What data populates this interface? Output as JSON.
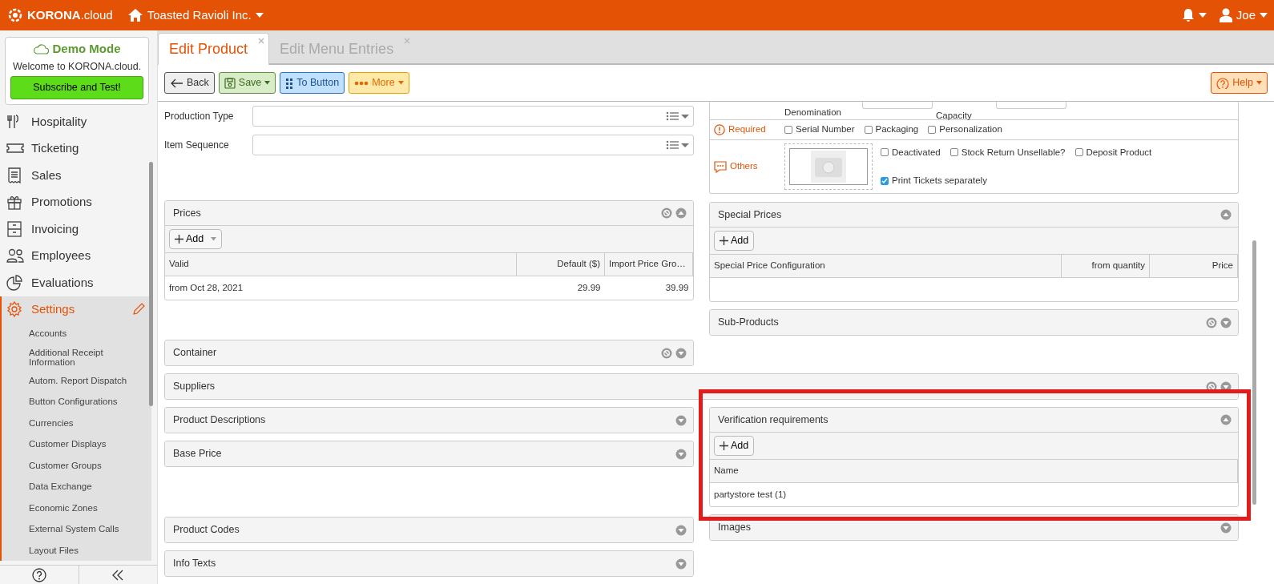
{
  "topbar": {
    "brand": "**KORONA**.cloud",
    "company": "Toasted Ravioli Inc.",
    "user": "Joe"
  },
  "demo": {
    "title": "Demo Mode",
    "text": "Welcome to KORONA.cloud.",
    "button": "Subscribe and Test!"
  },
  "sidebar": {
    "items": [
      {
        "label": "Hospitality",
        "selected": false
      },
      {
        "label": "Ticketing",
        "selected": false
      },
      {
        "label": "Sales",
        "selected": false
      },
      {
        "label": "Promotions",
        "selected": false
      },
      {
        "label": "Invoicing",
        "selected": false
      },
      {
        "label": "Employees",
        "selected": false
      },
      {
        "label": "Evaluations",
        "selected": false
      },
      {
        "label": "Settings",
        "selected": true,
        "children": [
          "Accounts",
          "Additional Receipt Information",
          "Autom. Report Dispatch",
          "Button Configurations",
          "Currencies",
          "Customer Displays",
          "Customer Groups",
          "Data Exchange",
          "Economic Zones",
          "External System Calls",
          "Layout Files"
        ]
      }
    ]
  },
  "tabs": [
    {
      "label": "Edit Product",
      "selected": true
    },
    {
      "label": "Edit Menu Entries",
      "selected": false
    }
  ],
  "toolbar": [
    {
      "label": "Back",
      "kind": "back",
      "dropdown": false
    },
    {
      "label": "Save",
      "kind": "save",
      "dropdown": true
    },
    {
      "label": "To Button",
      "kind": "grid",
      "dropdown": false
    },
    {
      "label": "More",
      "kind": "more",
      "dropdown": true
    }
  ],
  "help": {
    "label": "Help",
    "dropdown": true
  },
  "fields": [
    {
      "label": "Production Type"
    },
    {
      "label": "Item Sequence"
    }
  ],
  "properties": {
    "denomination_label": "Denomination",
    "capacity_label": "Capacity",
    "required": {
      "label": "Required",
      "options": [
        {
          "label": "Serial Number",
          "checked": false
        },
        {
          "label": "Packaging",
          "checked": false
        },
        {
          "label": "Personalization",
          "checked": false
        }
      ]
    },
    "others": {
      "label": "Others",
      "options": [
        {
          "label": "Deactivated",
          "checked": false
        },
        {
          "label": "Stock Return Unsellable?",
          "checked": false
        },
        {
          "label": "Deposit Product",
          "checked": false
        },
        {
          "label": "Print Tickets separately",
          "checked": true
        }
      ]
    }
  },
  "sections": [
    {
      "left": [
        {
          "title": "Prices",
          "expanded": true,
          "clearable": true,
          "add": {
            "label": "Add",
            "dropdown": true
          },
          "columns": [
            "Valid",
            "Default ($)",
            "Import Price Gro…"
          ],
          "rows": [
            [
              "from Oct 28, 2021",
              "29.99",
              "39.99"
            ]
          ]
        },
        {
          "title": "Container",
          "expanded": false,
          "clearable": true
        }
      ],
      "right": [
        {
          "title": "Special Prices",
          "expanded": true,
          "clearable": false,
          "add": {
            "label": "Add",
            "dropdown": false
          },
          "columns": [
            "Special Price Configuration",
            "from quantity",
            "Price"
          ]
        },
        {
          "title": "Sub-Products",
          "expanded": false,
          "clearable": true
        }
      ]
    },
    {
      "full": [
        {
          "title": "Suppliers",
          "expanded": false,
          "clearable": true
        }
      ]
    },
    {
      "left": [
        {
          "title": "Product Descriptions",
          "expanded": false,
          "clearable": false
        },
        {
          "title": "Base Price",
          "expanded": false,
          "clearable": false
        },
        {
          "title": "Product Codes",
          "expanded": false,
          "clearable": false
        },
        {
          "title": "Info Texts",
          "expanded": false,
          "clearable": false
        }
      ],
      "right": [
        {
          "title": "Verification requirements",
          "expanded": true,
          "clearable": false,
          "highlighted": true,
          "add": {
            "label": "Add",
            "dropdown": false
          },
          "columns": [
            "Name"
          ],
          "rows": [
            [
              "partystore test (1)"
            ]
          ]
        },
        {
          "title": "Images",
          "expanded": false,
          "clearable": false
        }
      ]
    }
  ]
}
